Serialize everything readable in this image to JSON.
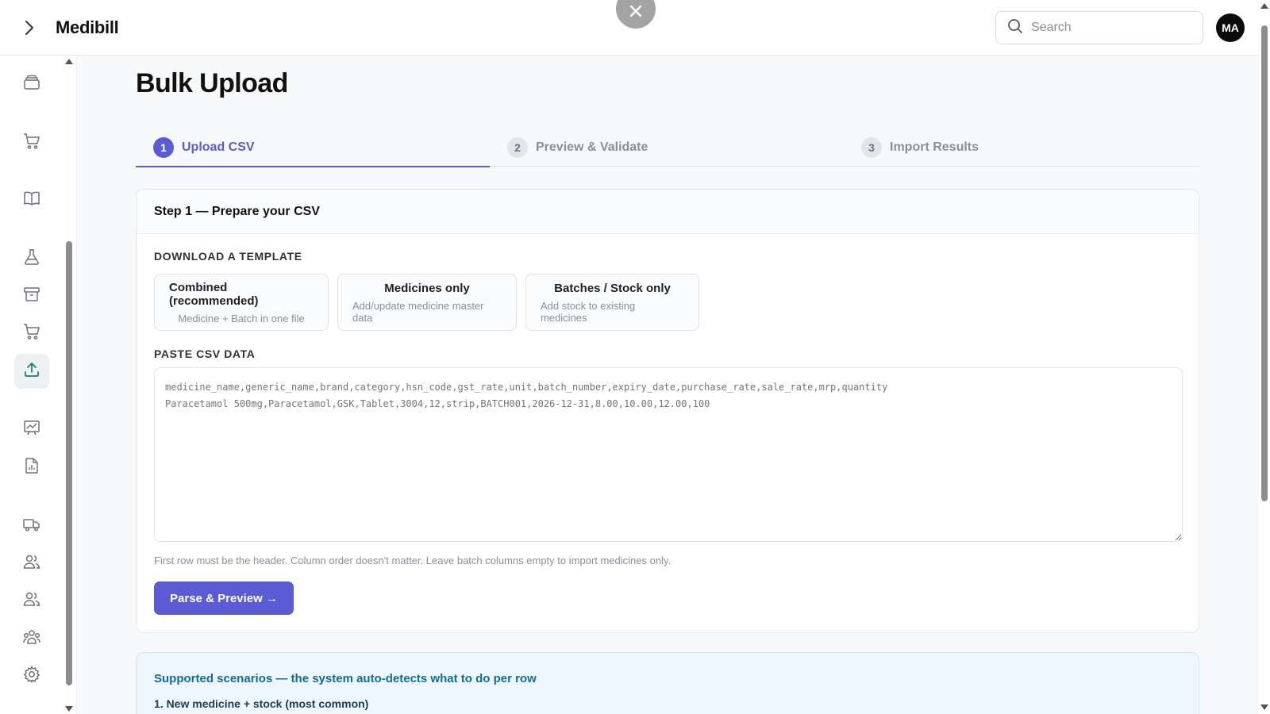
{
  "app": {
    "brand": "Medibill"
  },
  "header": {
    "search_placeholder": "Search",
    "avatar_initials": "MA"
  },
  "sidebar": {
    "items": [
      {
        "name": "inventory",
        "icon": "layers-icon",
        "active": false
      },
      {
        "name": "sales",
        "icon": "cart-icon",
        "active": false
      },
      {
        "name": "catalog",
        "icon": "book-icon",
        "active": false
      },
      {
        "name": "lab",
        "icon": "flask-icon",
        "active": false
      },
      {
        "name": "archive",
        "icon": "archive-icon",
        "active": false
      },
      {
        "name": "purchases",
        "icon": "cart-icon",
        "active": false
      },
      {
        "name": "bulk-upload",
        "icon": "upload-icon",
        "active": true
      },
      {
        "name": "analytics",
        "icon": "chart-board-icon",
        "active": false
      },
      {
        "name": "reports",
        "icon": "report-file-icon",
        "active": false
      },
      {
        "name": "delivery",
        "icon": "truck-icon",
        "active": false
      },
      {
        "name": "customers",
        "icon": "users-icon",
        "active": false
      },
      {
        "name": "staff",
        "icon": "users-icon",
        "active": false
      },
      {
        "name": "teams",
        "icon": "team-icon",
        "active": false
      },
      {
        "name": "settings",
        "icon": "gear-icon",
        "active": false
      }
    ]
  },
  "page": {
    "title": "Bulk Upload"
  },
  "steps": [
    {
      "num": "1",
      "label": "Upload CSV",
      "active": true
    },
    {
      "num": "2",
      "label": "Preview & Validate",
      "active": false
    },
    {
      "num": "3",
      "label": "Import Results",
      "active": false
    }
  ],
  "card": {
    "title": "Step 1 — Prepare your CSV",
    "download_label": "DOWNLOAD A TEMPLATE",
    "templates": [
      {
        "title": "Combined (recommended)",
        "subtitle": "Medicine + Batch in one file"
      },
      {
        "title": "Medicines only",
        "subtitle": "Add/update medicine master data"
      },
      {
        "title": "Batches / Stock only",
        "subtitle": "Add stock to existing medicines"
      }
    ],
    "paste_label": "PASTE CSV DATA",
    "csv_placeholder": "medicine_name,generic_name,brand,category,hsn_code,gst_rate,unit,batch_number,expiry_date,purchase_rate,sale_rate,mrp,quantity\nParacetamol 500mg,Paracetamol,GSK,Tablet,3004,12,strip,BATCH001,2026-12-31,8.00,10.00,12.00,100",
    "hint": "First row must be the header. Column order doesn't matter. Leave batch columns empty to import medicines only.",
    "parse_button": "Parse & Preview →"
  },
  "info": {
    "title": "Supported scenarios — the system auto-detects what to do per row",
    "item1": "1. New medicine + stock (most common)"
  },
  "colors": {
    "accent": "#5b5bd6",
    "info_title": "#126a9c",
    "info_bg": "#eef7fd"
  }
}
